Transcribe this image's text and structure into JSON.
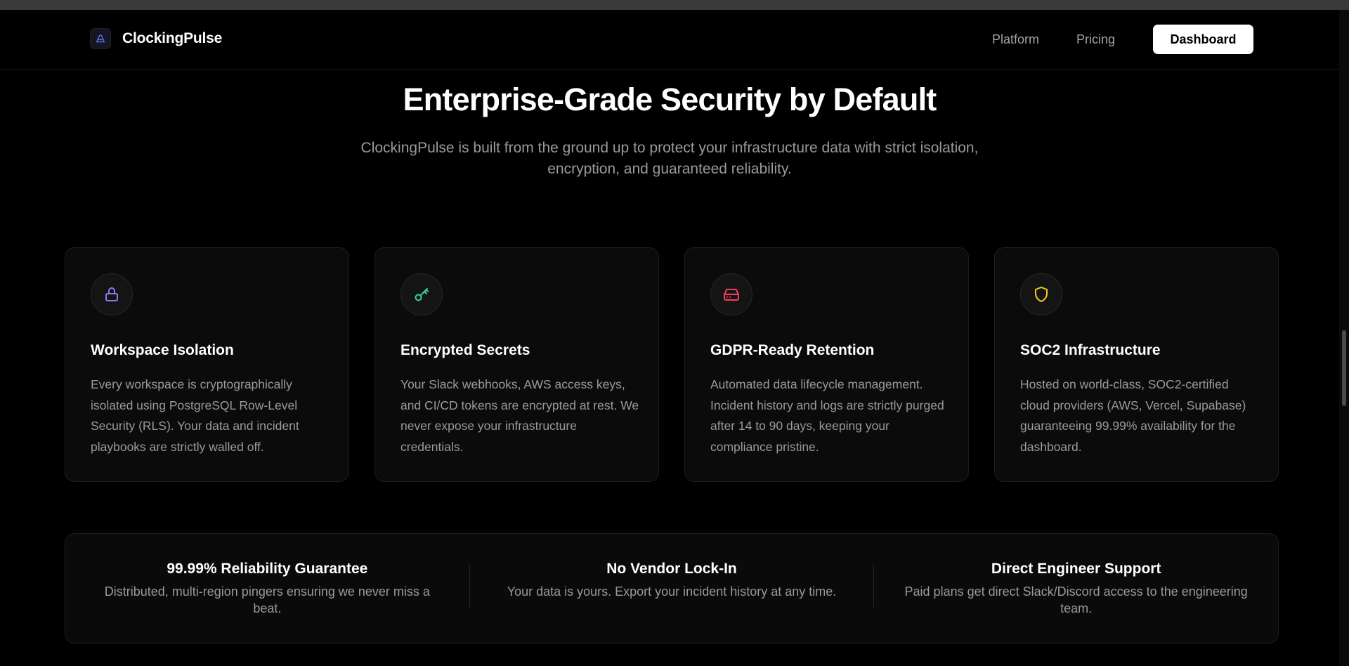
{
  "nav": {
    "brand": "ClockingPulse",
    "links": [
      "Platform",
      "Pricing"
    ],
    "cta": "Dashboard"
  },
  "hero": {
    "title": "Enterprise-Grade Security by Default",
    "subtitle": "ClockingPulse is built from the ground up to protect your infrastructure data with strict isolation, encryption, and guaranteed reliability."
  },
  "cards": [
    {
      "icon": "lock-icon",
      "color": "#8b7cf6",
      "title": "Workspace Isolation",
      "description": "Every workspace is cryptographically isolated using PostgreSQL Row-Level Security (RLS). Your data and incident playbooks are strictly walled off."
    },
    {
      "icon": "key-icon",
      "color": "#34d399",
      "title": "Encrypted Secrets",
      "description": "Your Slack webhooks, AWS access keys, and CI/CD tokens are encrypted at rest. We never expose your infrastructure credentials."
    },
    {
      "icon": "hard-drive-icon",
      "color": "#f43f5e",
      "title": "GDPR-Ready Retention",
      "description": "Automated data lifecycle management. Incident history and logs are strictly purged after 14 to 90 days, keeping your compliance pristine."
    },
    {
      "icon": "shield-icon",
      "color": "#facc15",
      "title": "SOC2 Infrastructure",
      "description": "Hosted on world-class, SOC2-certified cloud providers (AWS, Vercel, Supabase) guaranteeing 99.99% availability for the dashboard."
    }
  ],
  "features": [
    {
      "title": "99.99% Reliability Guarantee",
      "description": "Distributed, multi-region pingers ensuring we never miss a beat."
    },
    {
      "title": "No Vendor Lock-In",
      "description": "Your data is yours. Export your incident history at any time."
    },
    {
      "title": "Direct Engineer Support",
      "description": "Paid plans get direct Slack/Discord access to the engineering team."
    }
  ]
}
